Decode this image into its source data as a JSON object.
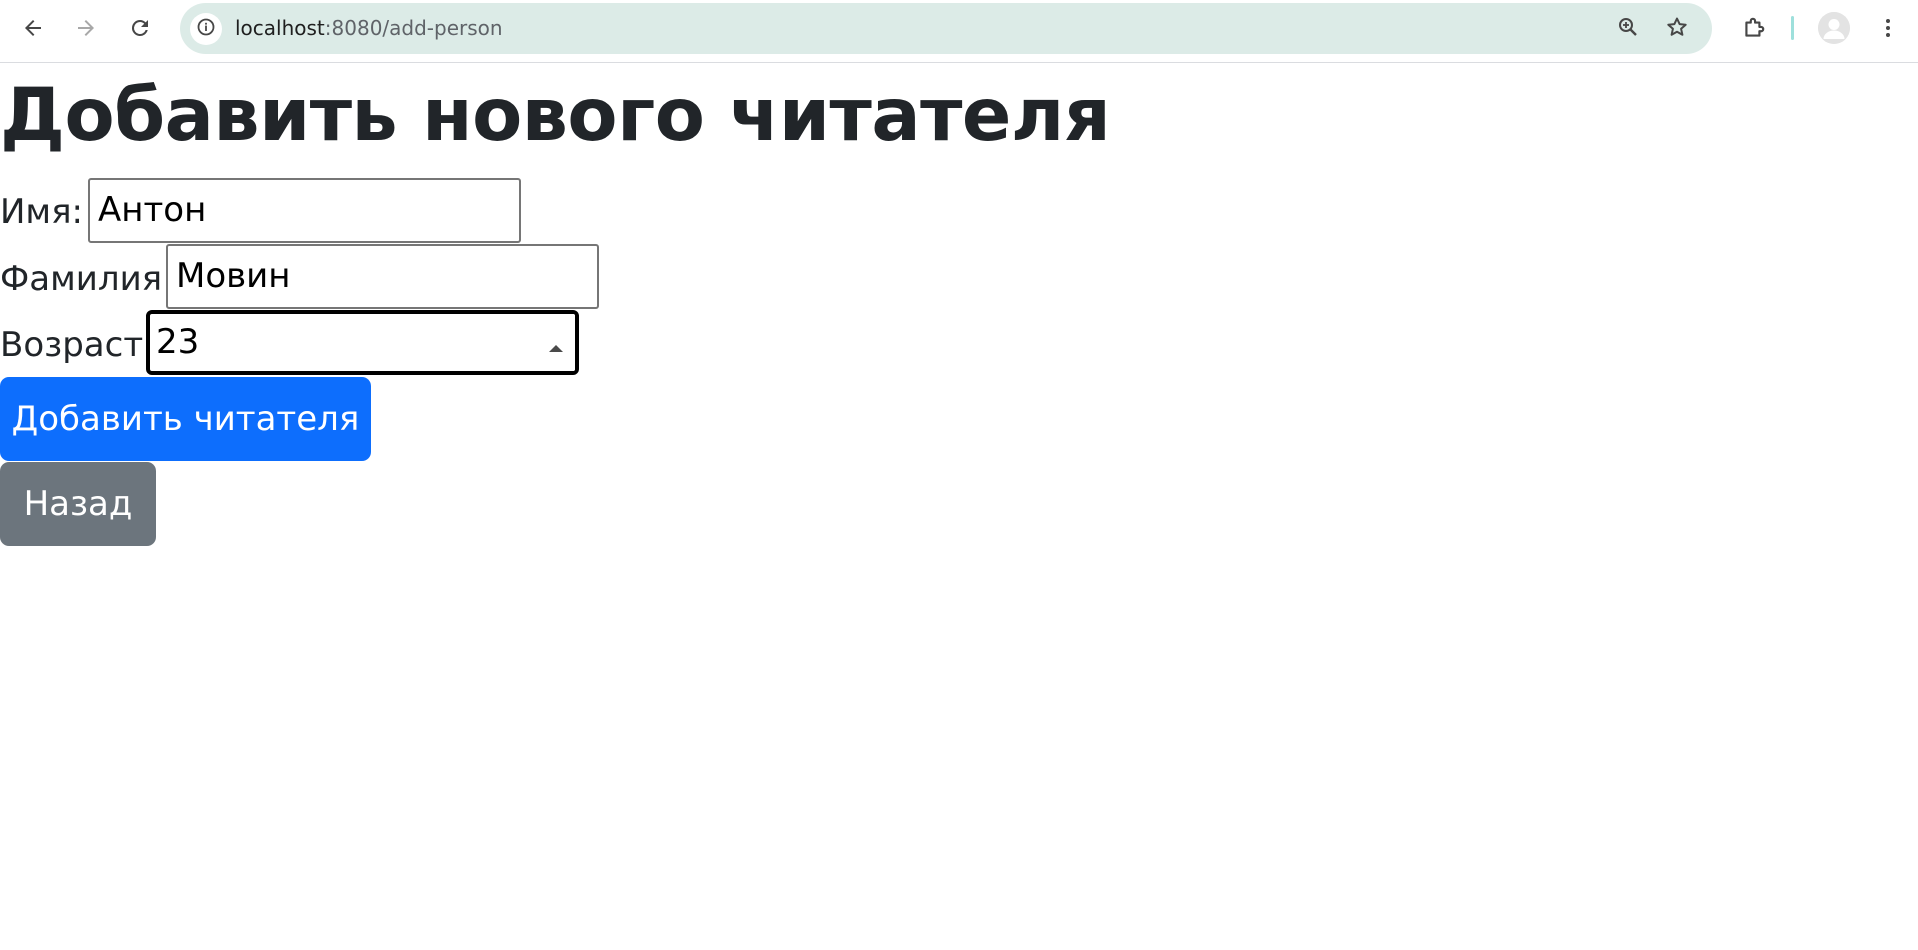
{
  "browser": {
    "url_host": "localhost",
    "url_path": ":8080/add-person",
    "back_icon": "arrow-left-icon",
    "forward_icon": "arrow-right-icon",
    "reload_icon": "reload-icon",
    "site_info_icon": "info-icon",
    "zoom_icon": "zoom-in-icon",
    "bookmark_icon": "star-icon",
    "extensions_icon": "puzzle-icon",
    "profile_icon": "avatar-icon",
    "menu_icon": "kebab-menu-icon",
    "omnibox_color": "#dcebe7"
  },
  "page": {
    "title": "Добавить нового читателя",
    "form": {
      "first_name": {
        "label": "Имя:",
        "value": "Антон"
      },
      "last_name": {
        "label": "Фамилия:",
        "value": "Мовин"
      },
      "age": {
        "label": "Возраст:",
        "value": "23"
      }
    },
    "buttons": {
      "submit_label": "Добавить читателя",
      "back_label": "Назад"
    }
  },
  "colors": {
    "primary": "#0d6efd",
    "secondary": "#6c757d",
    "text": "#212529"
  }
}
